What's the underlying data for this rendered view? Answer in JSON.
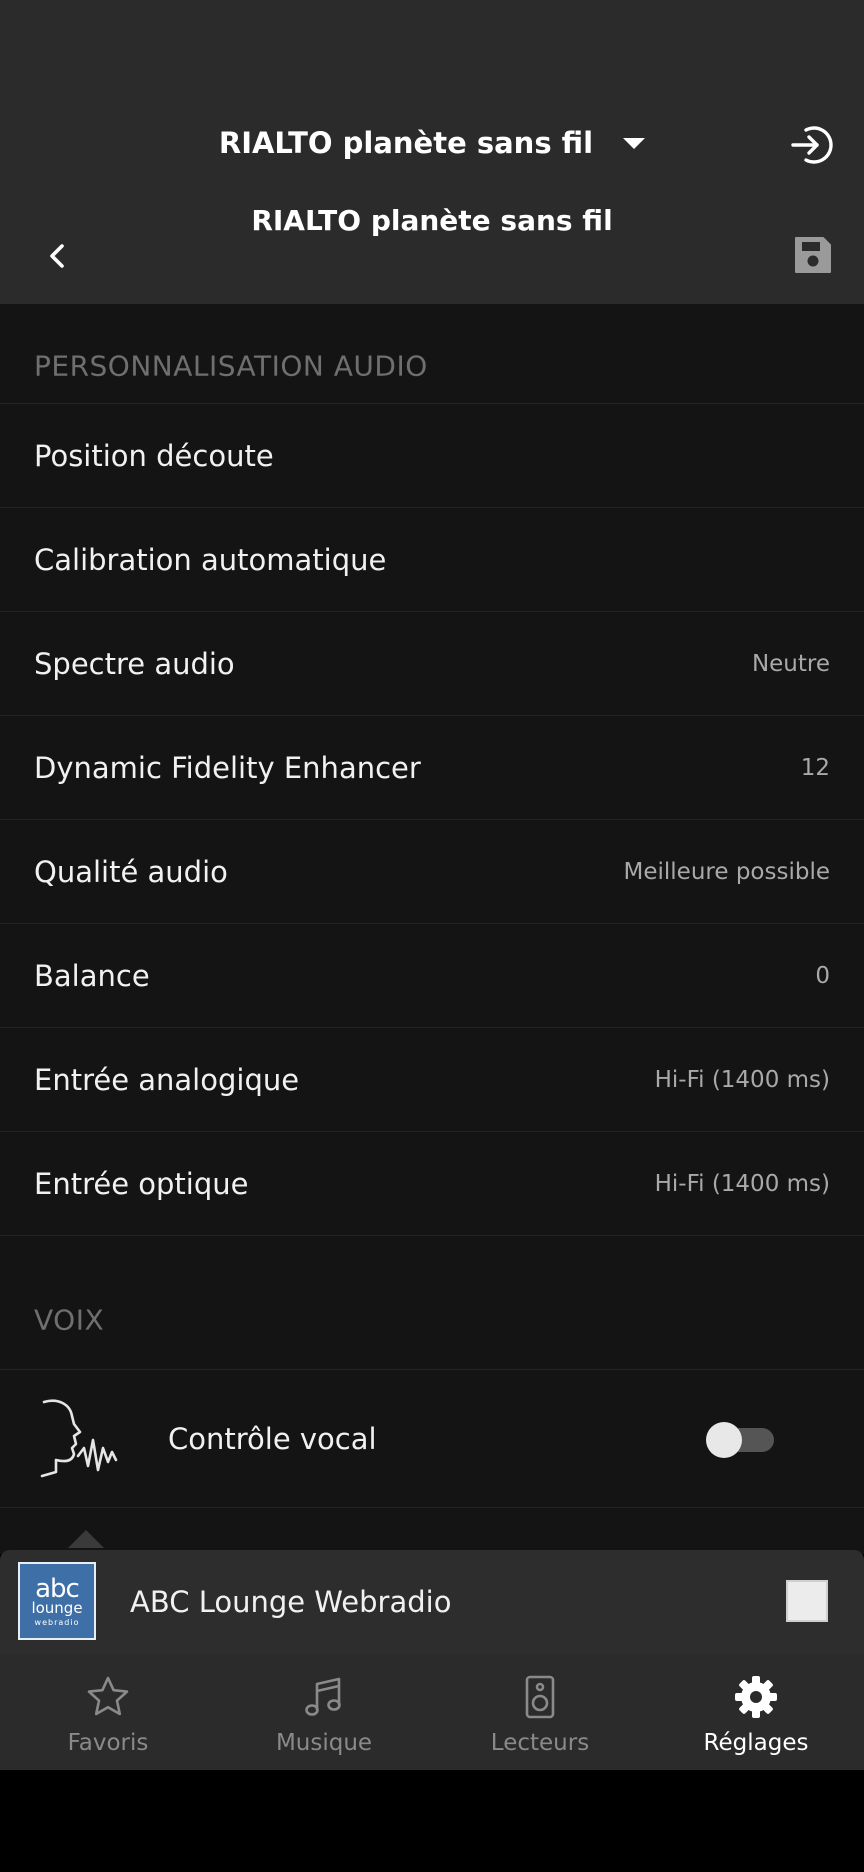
{
  "header": {
    "room_name": "RIALTO planète sans fil",
    "page_title": "RIALTO planète sans fil"
  },
  "sections": {
    "audio_title": "PERSONNALISATION AUDIO",
    "voice_title": "VOIX"
  },
  "audio_rows": [
    {
      "label": "Position découte",
      "value": ""
    },
    {
      "label": "Calibration automatique",
      "value": ""
    },
    {
      "label": "Spectre audio",
      "value": "Neutre"
    },
    {
      "label": "Dynamic Fidelity Enhancer",
      "value": "12"
    },
    {
      "label": "Qualité audio",
      "value": "Meilleure possible"
    },
    {
      "label": "Balance",
      "value": "0"
    },
    {
      "label": "Entrée analogique",
      "value": "Hi-Fi (1400 ms)"
    },
    {
      "label": "Entrée optique",
      "value": "Hi-Fi (1400 ms)"
    }
  ],
  "voice": {
    "label": "Contrôle vocal",
    "enabled": false
  },
  "player": {
    "album_art_lines": [
      "abc",
      "lounge",
      "webradio"
    ],
    "track_title": "ABC Lounge Webradio"
  },
  "tabs": [
    {
      "label": "Favoris",
      "icon": "star-icon",
      "active": false
    },
    {
      "label": "Musique",
      "icon": "music-note-icon",
      "active": false
    },
    {
      "label": "Lecteurs",
      "icon": "speaker-icon",
      "active": false
    },
    {
      "label": "Réglages",
      "icon": "gear-icon",
      "active": true
    }
  ],
  "colors": {
    "header_bg": "#2b2b2b",
    "content_bg": "#141414",
    "active_tab": "#ffffff",
    "inactive_tab": "#8a8a8a",
    "album_art_bg": "#3f6fa7"
  }
}
